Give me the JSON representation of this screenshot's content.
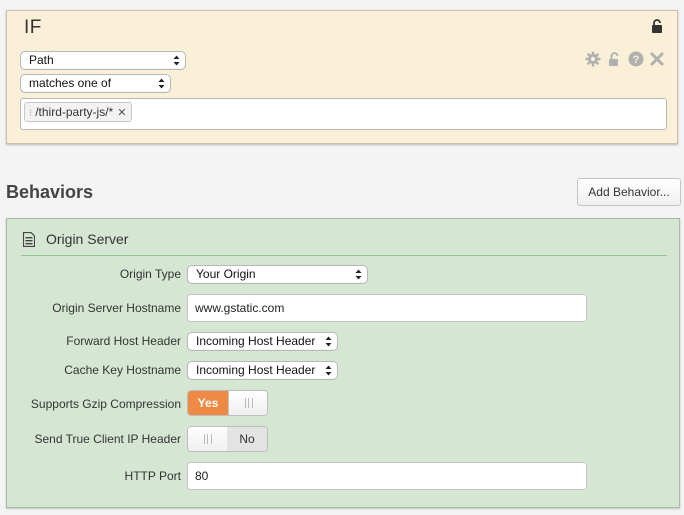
{
  "criteria": {
    "title": "IF",
    "field_select": "Path",
    "operator_select": "matches one of",
    "values": [
      "/third-party-js/*"
    ],
    "icons": [
      "lock-open-icon",
      "gear-icon",
      "lock-open-icon",
      "help-icon",
      "close-icon"
    ]
  },
  "behaviors": {
    "title": "Behaviors",
    "add_button": "Add Behavior..."
  },
  "origin": {
    "title": "Origin Server",
    "icon": "document-icon",
    "origin_type": {
      "label": "Origin Type",
      "value": "Your Origin"
    },
    "hostname": {
      "label": "Origin Server Hostname",
      "value": "www.gstatic.com"
    },
    "forward_host_header": {
      "label": "Forward Host Header",
      "value": "Incoming Host Header"
    },
    "cache_key_hostname": {
      "label": "Cache Key Hostname",
      "value": "Incoming Host Header"
    },
    "gzip": {
      "label": "Supports Gzip Compression",
      "state": "Yes"
    },
    "true_client_ip": {
      "label": "Send True Client IP Header",
      "state": "No"
    },
    "http_port": {
      "label": "HTTP Port",
      "value": "80"
    }
  },
  "colors": {
    "criteria_bg": "#faf0d8",
    "behavior_bg": "#d5e7d3",
    "toggle_on": "#ef8a44"
  }
}
